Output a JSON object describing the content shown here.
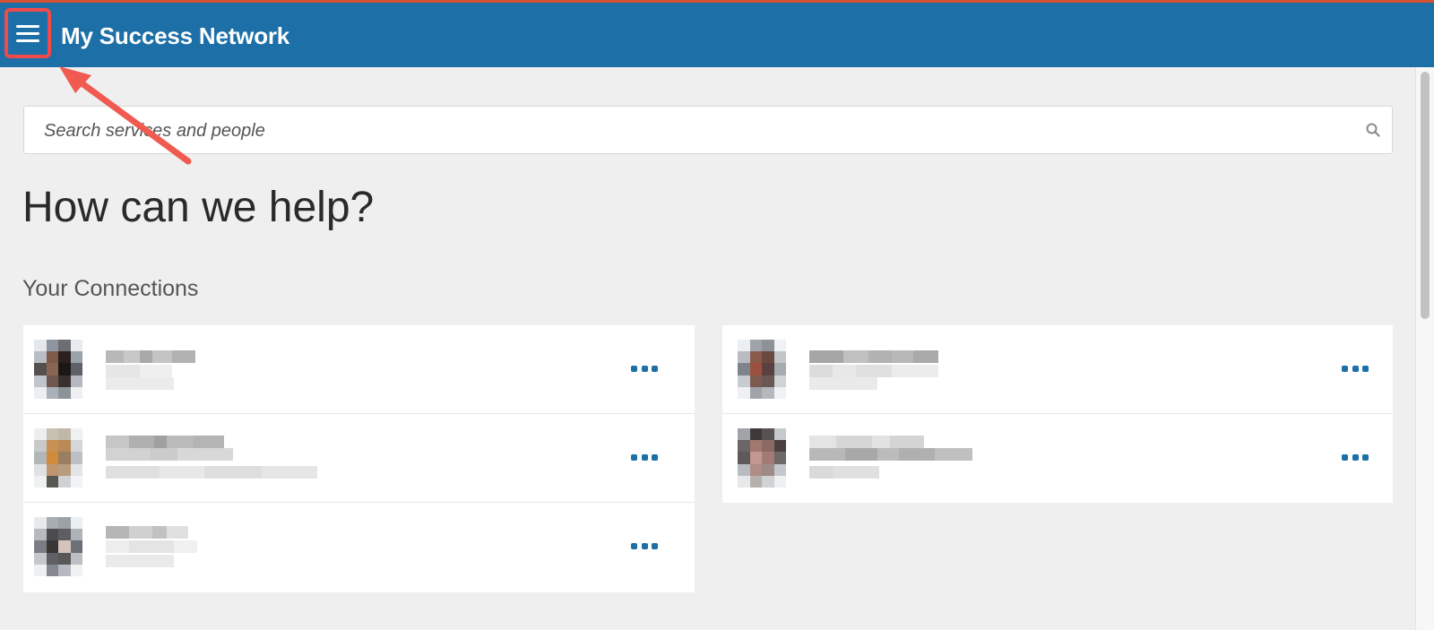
{
  "header": {
    "title": "My Success Network",
    "menu_icon": "hamburger-menu-icon",
    "bg_color": "#1d70a7",
    "accent_line_color": "#d4532e"
  },
  "search": {
    "placeholder": "Search services and people",
    "value": "",
    "icon": "search-icon"
  },
  "main": {
    "headline": "How can we help?",
    "connections_title": "Your Connections"
  },
  "connections": {
    "left": [
      {
        "name": "",
        "detail": "",
        "more_icon": "more-options-icon"
      },
      {
        "name": "",
        "detail": "",
        "more_icon": "more-options-icon"
      },
      {
        "name": "",
        "detail": "",
        "more_icon": "more-options-icon"
      }
    ],
    "right": [
      {
        "name": "",
        "detail": "",
        "more_icon": "more-options-icon"
      },
      {
        "name": "",
        "detail": "",
        "more_icon": "more-options-icon"
      }
    ]
  },
  "annotation": {
    "highlight_color": "#f04a4a",
    "arrow_color": "#f05a50"
  }
}
